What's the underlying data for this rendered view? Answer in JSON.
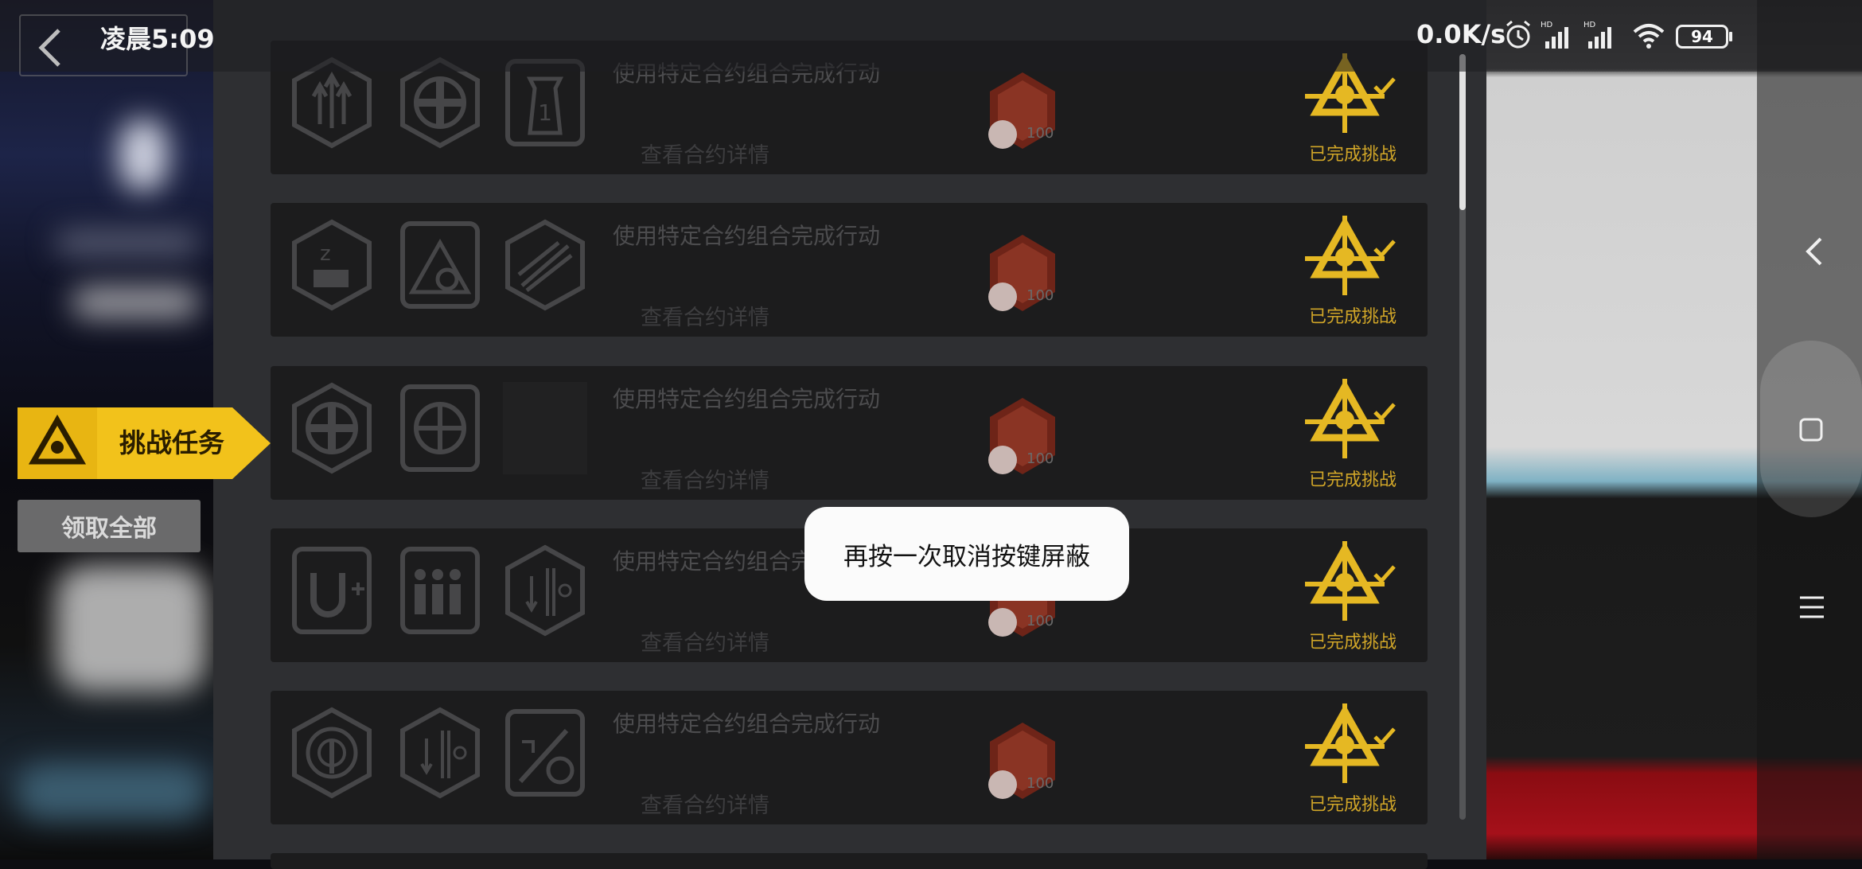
{
  "status_bar": {
    "time": "凌晨5:09",
    "network_speed": "0.0K/s",
    "battery": "94",
    "icons": [
      "alarm-icon",
      "signal-hd-icon",
      "signal-hd-icon",
      "wifi-icon",
      "battery-icon"
    ]
  },
  "sidebar": {
    "challenge_tab_label": "挑战任务",
    "claim_all_label": "领取全部"
  },
  "tasks": [
    {
      "title": "使用特定合约组合完成行动",
      "detail_link": "查看合约详情",
      "reward_amount": "100",
      "status": "已完成挑战",
      "icons": [
        "triple-arrow-hex-icon",
        "cross-hex-icon",
        "tower-one-icon"
      ]
    },
    {
      "title": "使用特定合约组合完成行动",
      "detail_link": "查看合约详情",
      "reward_amount": "100",
      "status": "已完成挑战",
      "icons": [
        "sleep-hex-icon",
        "cost-triangle-icon",
        "blade-hex-icon"
      ]
    },
    {
      "title": "使用特定合约组合完成行动",
      "detail_link": "查看合约详情",
      "reward_amount": "100",
      "status": "已完成挑战",
      "icons": [
        "cross-hex-icon",
        "radar-square-icon",
        "snowflake-blank-icon"
      ]
    },
    {
      "title": "使用特定合约组合完成行动",
      "detail_link": "查看合约详情",
      "reward_amount": "100",
      "status": "已完成挑战",
      "icons": [
        "magnet-plus-icon",
        "people-square-icon",
        "no-down-hex-icon"
      ]
    },
    {
      "title": "使用特定合约组合完成行动",
      "detail_link": "查看合约详情",
      "reward_amount": "100",
      "status": "已完成挑战",
      "icons": [
        "target-hex-icon",
        "no-down-hex-icon",
        "sword-clock-icon"
      ]
    }
  ],
  "toast": {
    "message": "再按一次取消按键屏蔽"
  },
  "colors": {
    "accent_yellow": "#f2c21b",
    "completed_gold": "#d1a628",
    "card_bg": "#1c1c1d",
    "panel_bg": "#2e2f32"
  }
}
